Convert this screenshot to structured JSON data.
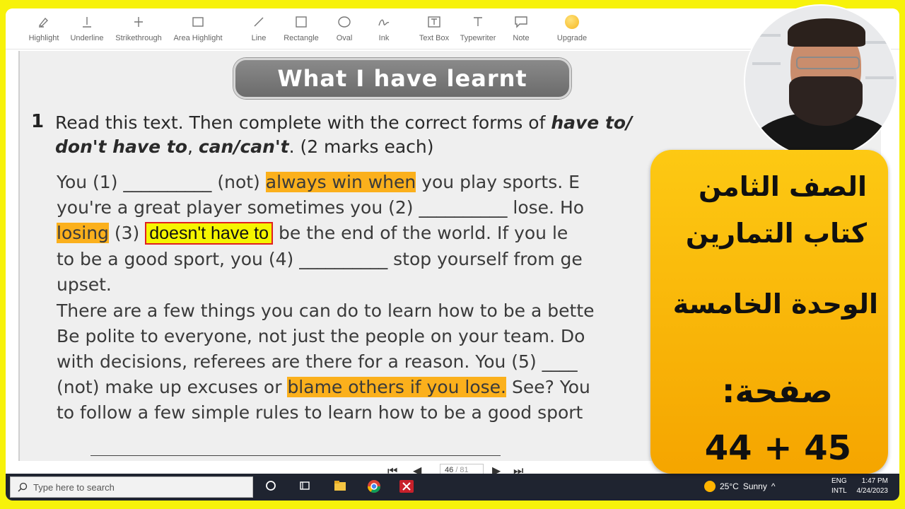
{
  "toolbar": {
    "tools": [
      {
        "label": "Highlight",
        "icon": "highlight-pen-icon"
      },
      {
        "label": "Underline",
        "icon": "underline-icon"
      },
      {
        "label": "Strikethrough",
        "icon": "strikethrough-icon"
      },
      {
        "label": "Area Highlight",
        "icon": "area-highlight-icon"
      },
      {
        "label": "Line",
        "icon": "line-icon"
      },
      {
        "label": "Rectangle",
        "icon": "rectangle-icon"
      },
      {
        "label": "Oval",
        "icon": "oval-icon"
      },
      {
        "label": "Ink",
        "icon": "ink-icon"
      },
      {
        "label": "Text Box",
        "icon": "text-box-icon"
      },
      {
        "label": "Typewriter",
        "icon": "typewriter-icon"
      },
      {
        "label": "Note",
        "icon": "note-icon"
      },
      {
        "label": "Upgrade",
        "icon": "upgrade-icon"
      }
    ]
  },
  "document": {
    "banner": "What I have learnt",
    "question_number": "1",
    "instruction_part1": "Read this text. Then complete with the correct forms of ",
    "instruction_em1": "have to/",
    "instruction_em2": "don't have to",
    "instruction_sep": ", ",
    "instruction_em3": "can/can't",
    "instruction_part2": ". (2 marks each)",
    "line1_a": "You (1) __________ (not) ",
    "line1_hl": "always win when",
    "line1_b": " you play sports. E",
    "line2": "you're a great player sometimes you (2) __________ lose. Ho",
    "line3_hl": "losing",
    "line3_a": " (3) ",
    "line3_answer": "doesn't have to",
    "line3_b": " be the end of the world. If you le",
    "line4": "to be a good sport, you (4) __________ stop yourself from ge",
    "line5": "upset.",
    "line6": "There are a few things you can do to learn how to be a bette",
    "line7": "Be polite to everyone, not just the people on your team. Do",
    "line8": "with decisions, referees are there for a reason. You (5) ____",
    "line9_a": "(not) make up excuses or ",
    "line9_hl": "blame others if you lose.",
    "line9_b": " See? You",
    "line10": "to follow a few simple rules to learn how to be a good sport"
  },
  "pagenav": {
    "current_page": "46",
    "total_pages": "/ 81"
  },
  "taskbar": {
    "search_placeholder": "Type here to search",
    "weather_temp": "25°C",
    "weather_text": "Sunny",
    "lang_line1": "ENG",
    "lang_line2": "INTL",
    "time": "1:47 PM",
    "date": "4/24/2023"
  },
  "card": {
    "grade": "الصف الثامن",
    "book": "كتاب التمارين",
    "unit": "الوحدة الخامسة",
    "page_label": "صفحة:",
    "pages": "44 + 45"
  },
  "colors": {
    "background": "#f7f20a",
    "highlight_orange": "#fbb01c",
    "highlight_yellow": "#f5f500",
    "answer_border": "#e02020",
    "card": "#fdc913"
  }
}
